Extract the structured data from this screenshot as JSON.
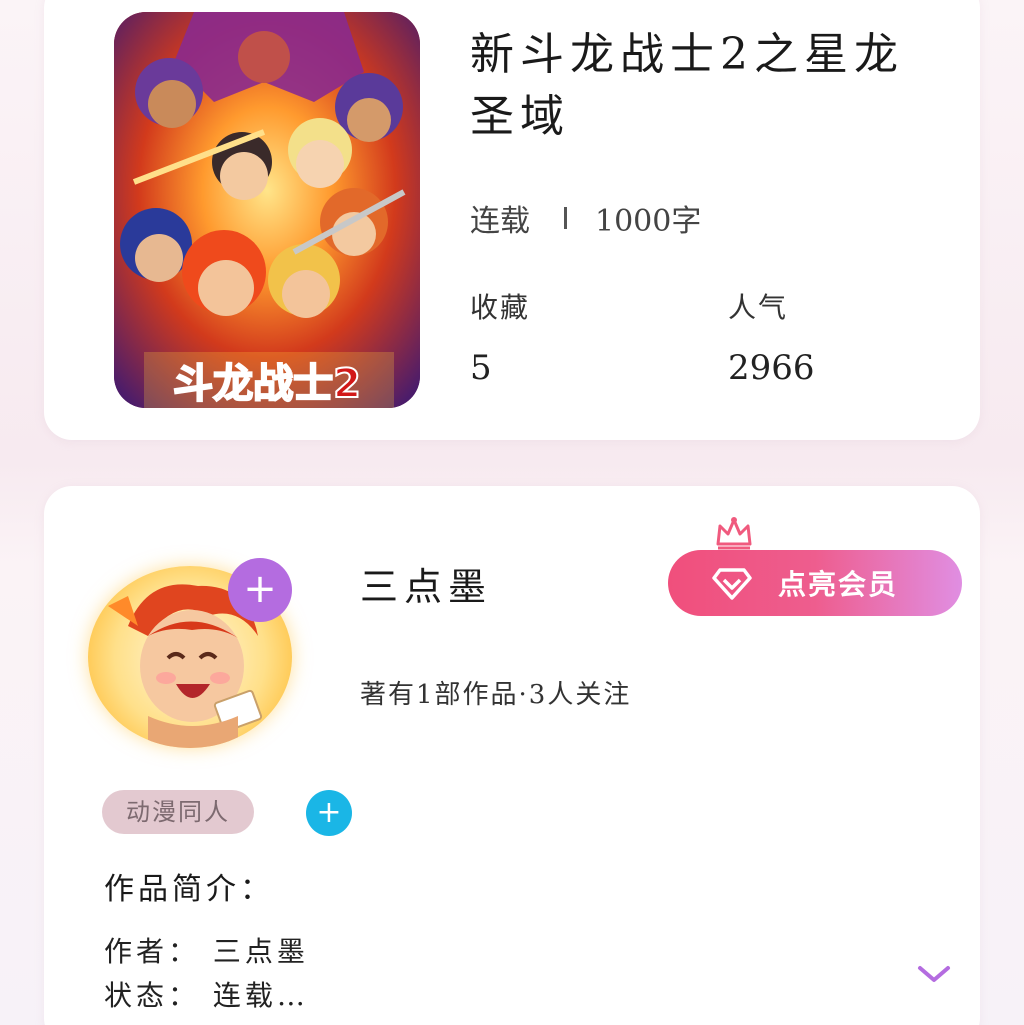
{
  "book": {
    "title": "新斗龙战士2之星龙圣域",
    "status": "连载",
    "word_count": "1000字",
    "favorites_label": "收藏",
    "favorites_value": "5",
    "popularity_label": "人气",
    "popularity_value": "2966",
    "cover_text": "斗龙战士2"
  },
  "author": {
    "name": "三点墨",
    "stats": "著有1部作品·3人关注",
    "follow_symbol": "+",
    "vip_button_label": "点亮会员"
  },
  "tags": {
    "items": [
      "动漫同人"
    ],
    "add_symbol": "+"
  },
  "intro": {
    "heading": "作品简介：",
    "author_line": "作者：  三点墨",
    "status_line": "状态：  连载…"
  },
  "icons": {
    "vip": "diamond-icon",
    "crown": "crown-icon",
    "expand": "chevron-down-icon"
  },
  "colors": {
    "vip_gradient_start": "#f04f7c",
    "vip_gradient_end": "#e08ee2",
    "follow_badge": "#b46ce0",
    "add_tag": "#1ab6e6",
    "tag_bg": "#e3c9d0",
    "chevron": "#b46ce0"
  }
}
